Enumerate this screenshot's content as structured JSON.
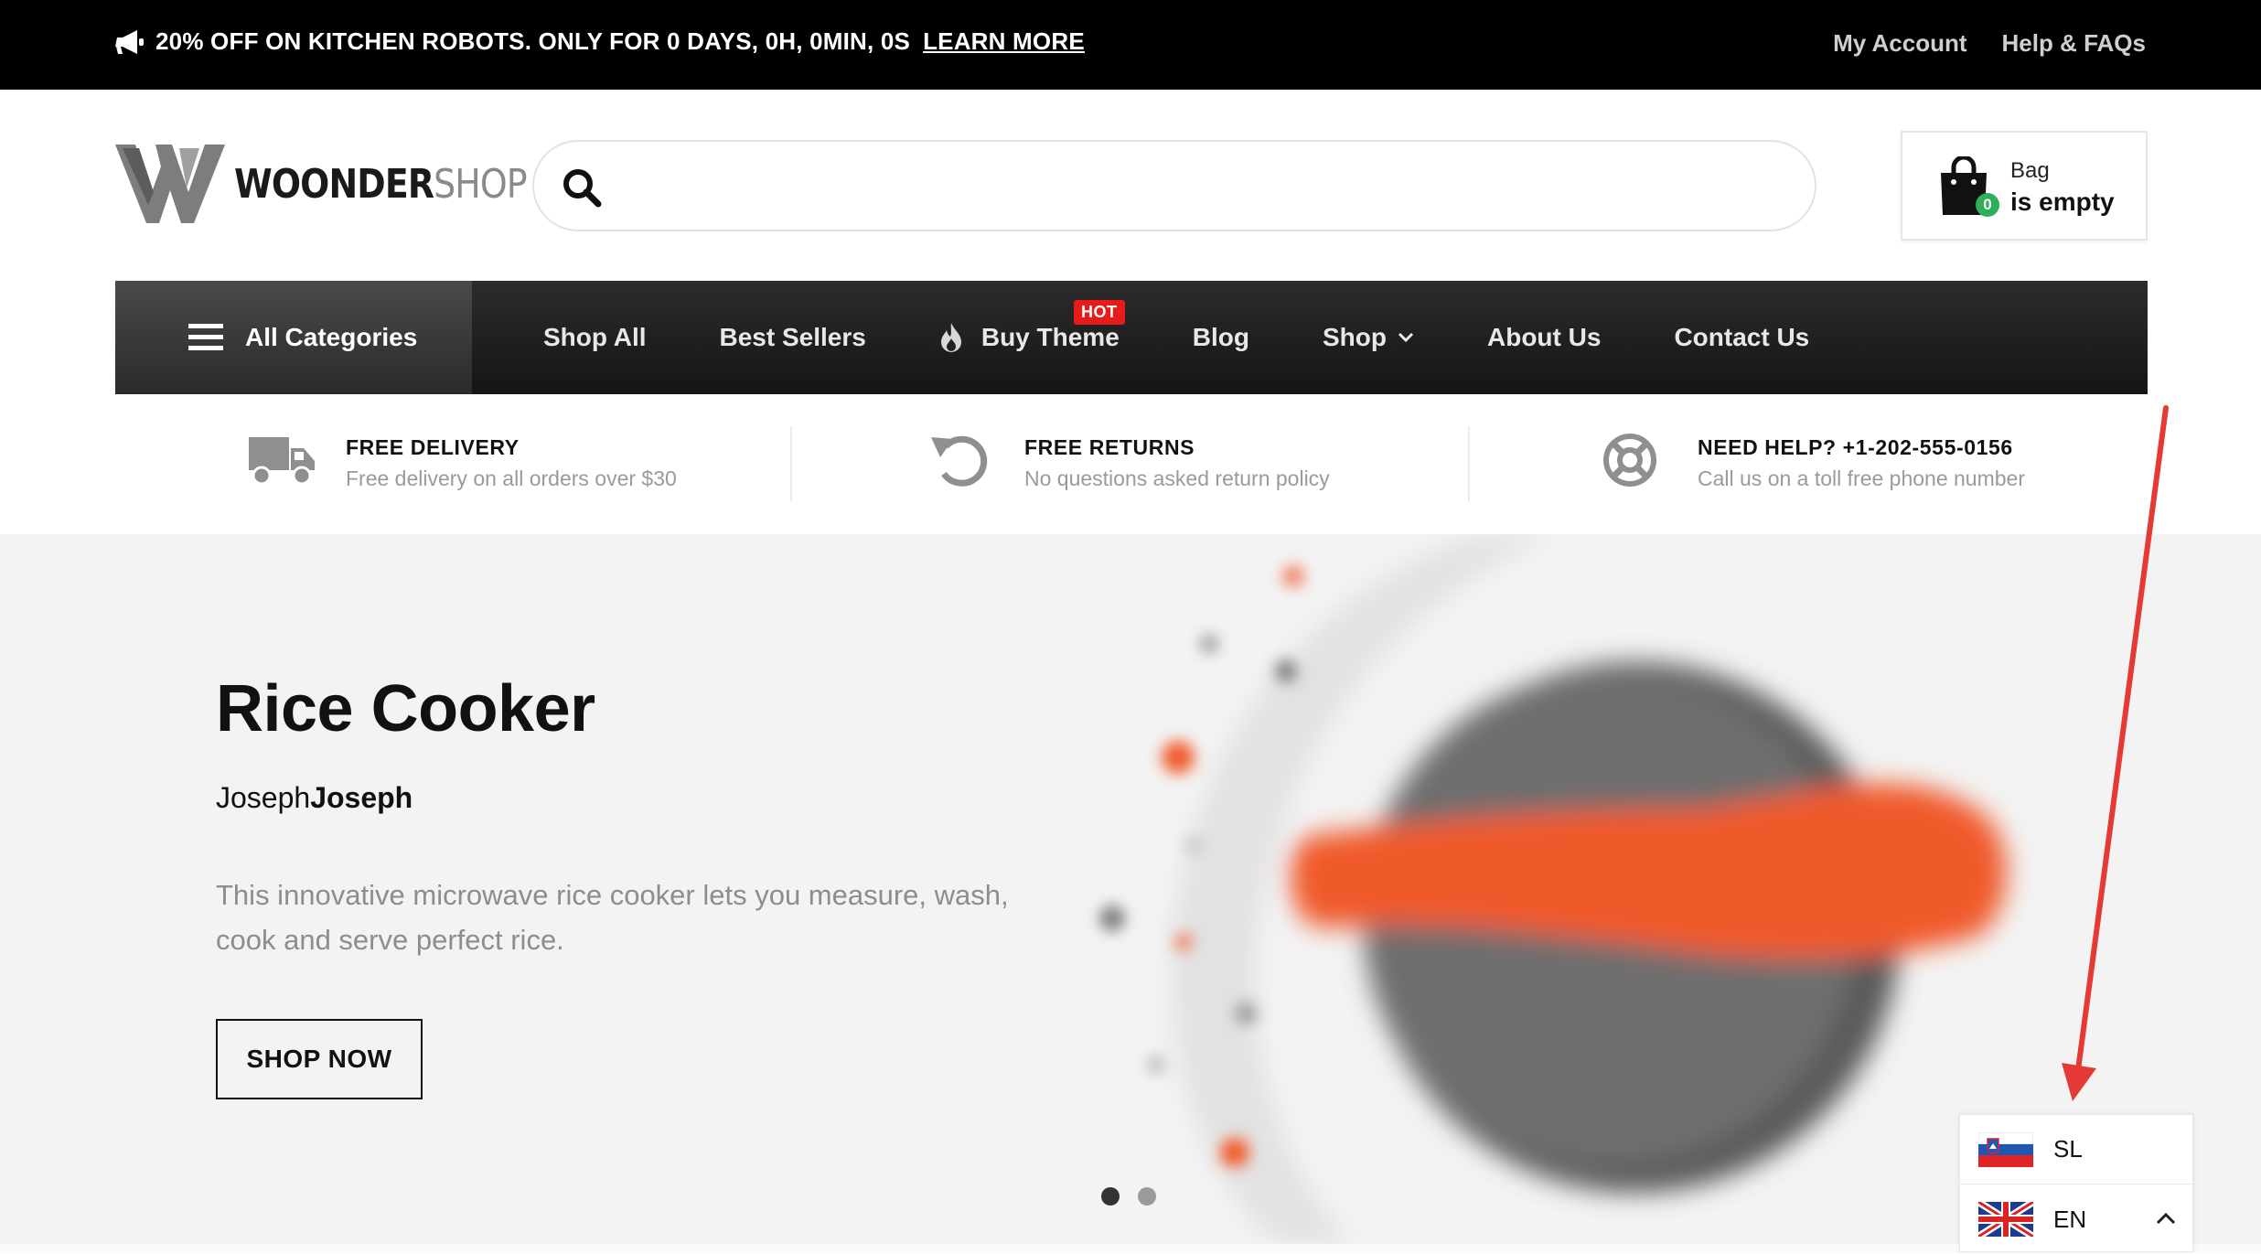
{
  "topbar": {
    "promo_text": "20% OFF ON KITCHEN ROBOTS. ONLY FOR 0 DAYS, 0H, 0MIN, 0S",
    "promo_link": "LEARN MORE",
    "links": [
      "My Account",
      "Help & FAQs"
    ]
  },
  "header": {
    "logo_part1": "WOONDER",
    "logo_part2": "SHOP",
    "search_placeholder": "",
    "bag_label": "Bag",
    "bag_status": "is empty",
    "bag_count": "0"
  },
  "nav": {
    "all_categories": "All Categories",
    "items": [
      "Shop All",
      "Best Sellers",
      "Buy Theme",
      "Blog",
      "Shop",
      "About Us",
      "Contact Us"
    ],
    "hot_badge": "HOT"
  },
  "features": [
    {
      "title": "FREE DELIVERY",
      "subtitle": "Free delivery on all orders over $30",
      "icon": "truck-icon"
    },
    {
      "title": "FREE RETURNS",
      "subtitle": "No questions asked return policy",
      "icon": "return-icon"
    },
    {
      "title": "NEED HELP? +1-202-555-0156",
      "subtitle": "Call us on a toll free phone number",
      "icon": "lifebuoy-icon"
    }
  ],
  "hero": {
    "title": "Rice Cooker",
    "brand_light": "Joseph",
    "brand_bold": "Joseph",
    "description": "This innovative microwave rice cooker lets you measure, wash, cook and serve perfect rice.",
    "cta": "SHOP NOW",
    "slides": 2,
    "active_slide": 1
  },
  "language": {
    "options": [
      {
        "code": "SL",
        "flag": "slovenia-flag-icon"
      },
      {
        "code": "EN",
        "flag": "uk-flag-icon"
      }
    ]
  },
  "colors": {
    "hot": "#e81a1a",
    "bag_count": "#2fae5b",
    "arrow": "#e53935",
    "product_accent": "#f05a2a"
  }
}
